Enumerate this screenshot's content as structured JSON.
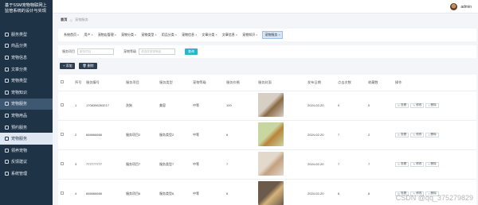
{
  "sidebar": {
    "system_title": "基于SSM宠物物联网上监管系统的设计与实现",
    "items": [
      {
        "label": "服务类型",
        "icon": "grid-icon"
      },
      {
        "label": "商品分类",
        "icon": "tag-icon"
      },
      {
        "label": "宠物信息",
        "icon": "paw-icon"
      },
      {
        "label": "文章分类",
        "icon": "folder-icon"
      },
      {
        "label": "宠物类型",
        "icon": "list-icon"
      },
      {
        "label": "宠物知识",
        "icon": "book-icon"
      },
      {
        "label": "宠物服务",
        "icon": "service-icon"
      },
      {
        "label": "宠物用品",
        "icon": "bag-icon"
      },
      {
        "label": "预约服务",
        "icon": "calendar-icon"
      },
      {
        "label": "宠物服务",
        "icon": "service-icon"
      },
      {
        "label": "领养宠物",
        "icon": "heart-icon"
      },
      {
        "label": "反馈建议",
        "icon": "message-icon"
      },
      {
        "label": "系统管理",
        "icon": "settings-icon"
      }
    ]
  },
  "header": {
    "username": "admin"
  },
  "breadcrumb": {
    "home": "首页",
    "current": "宠物服务"
  },
  "tags": [
    "系统首页",
    "用户",
    "宠物店管理",
    "宠物分类",
    "宠物类型",
    "用品分类",
    "宠物信息",
    "文章分类",
    "文章信息",
    "宠物知识",
    "宠物服务"
  ],
  "search": {
    "label1": "服务项目",
    "placeholder1": "服务项目",
    "label2": "宠物等级",
    "placeholder2": "请选择宠物等级",
    "button": "查询"
  },
  "actions": {
    "add": "添加",
    "delete": "删除"
  },
  "table": {
    "headers": [
      "",
      "序号",
      "服务编号",
      "服务项目",
      "服务类型",
      "宠物等级",
      "服务价格",
      "服务封面",
      "发布日期",
      "点击次数",
      "收藏数",
      "操作"
    ],
    "rows": [
      {
        "no": "1",
        "code": "1708396263217",
        "item": "洗狗",
        "type": "美容",
        "level": "中等",
        "price": "100",
        "date": "2024-02-20",
        "clicks": "0",
        "favs": "0",
        "photo_colors": [
          "#d7cfc4",
          "#8a6a45"
        ]
      },
      {
        "no": "2",
        "code": "666666666",
        "item": "服务项目2",
        "type": "服务类型2",
        "level": "中等",
        "price": "6",
        "date": "2024-02-20",
        "clicks": "7",
        "favs": "2",
        "photo_colors": [
          "#c9d6a0",
          "#b9843b"
        ]
      },
      {
        "no": "3",
        "code": "777777777",
        "item": "服务项目7",
        "type": "服务类型7",
        "level": "中等",
        "price": "7",
        "date": "2024-02-20",
        "clicks": "7",
        "favs": "7",
        "photo_colors": [
          "#e3d8cc",
          "#c3a180"
        ]
      },
      {
        "no": "4",
        "code": "666666666",
        "item": "服务项目6",
        "type": "服务类型6",
        "level": "中等",
        "price": "6",
        "date": "2024-02-20",
        "clicks": "6",
        "favs": "6",
        "photo_colors": [
          "#6c5a4a",
          "#d6b37c"
        ]
      }
    ],
    "op_view": "查看",
    "op_edit": "修改",
    "op_delete": "删除"
  },
  "watermark": "CSDN @qq_375279829",
  "colors": {
    "sidebar": "#1f3346",
    "accent": "#2bb5c9",
    "dark_button": "#2c3e50"
  }
}
